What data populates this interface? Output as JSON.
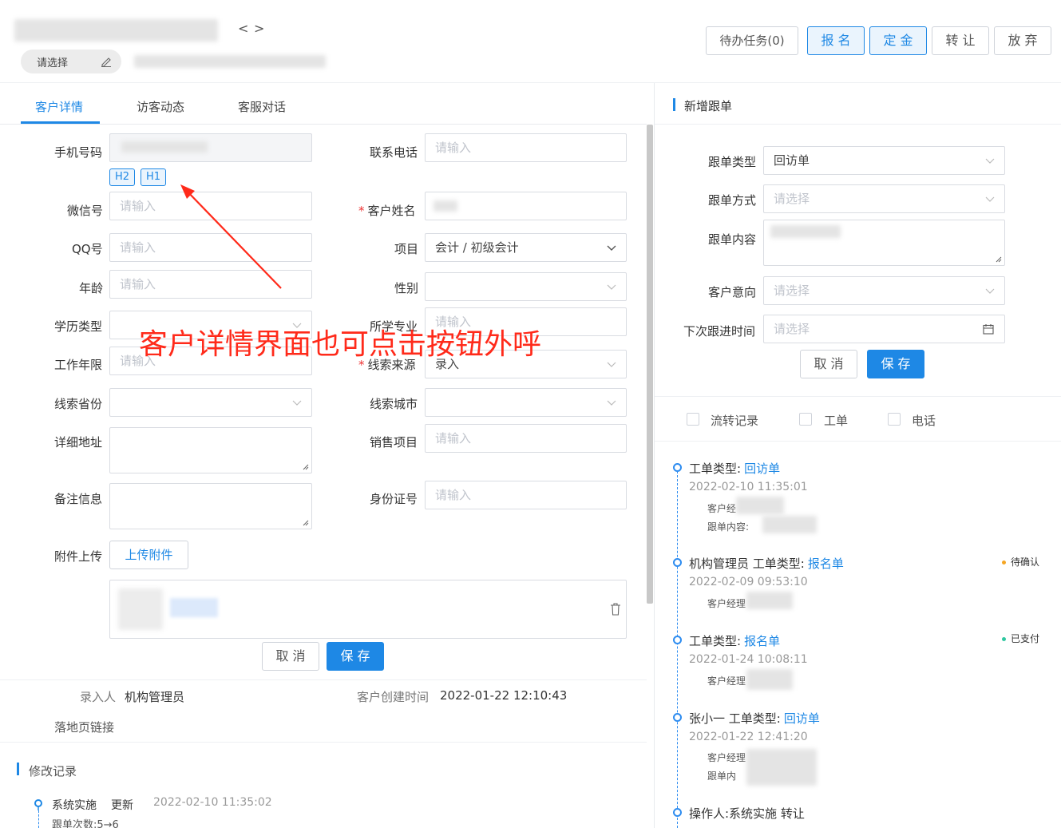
{
  "header": {
    "nav_prev": "<",
    "nav_next": ">",
    "select_placeholder": "请选择",
    "buttons": {
      "todo": "待办任务(0)",
      "enroll": "报 名",
      "deposit": "定 金",
      "transfer": "转 让",
      "abandon": "放 弃"
    }
  },
  "tabs": [
    "客户详情",
    "访客动态",
    "客服对话"
  ],
  "form": {
    "mobile_label": "手机号码",
    "tags": [
      "H2",
      "H1"
    ],
    "phone_label": "联系电话",
    "phone_placeholder": "请输入",
    "wechat_label": "微信号",
    "wechat_placeholder": "请输入",
    "name_label": "客户姓名",
    "qq_label": "QQ号",
    "qq_placeholder": "请输入",
    "project_label": "项目",
    "project_value": "会计 / 初级会计",
    "age_label": "年龄",
    "age_placeholder": "请输入",
    "gender_label": "性别",
    "edu_label": "学历类型",
    "major_label": "所学专业",
    "major_placeholder": "请输入",
    "work_label": "工作年限",
    "work_placeholder": "请输入",
    "source_label": "线索来源",
    "source_value": "录入",
    "province_label": "线索省份",
    "city_label": "线索城市",
    "address_label": "详细地址",
    "sales_label": "销售项目",
    "sales_placeholder": "请输入",
    "remark_label": "备注信息",
    "idcard_label": "身份证号",
    "idcard_placeholder": "请输入",
    "upload_label": "附件上传",
    "upload_button": "上传附件",
    "cancel": "取 消",
    "save": "保 存"
  },
  "annotation": "客户详情界面也可点击按钮外呼",
  "meta": {
    "creator_label": "录入人",
    "creator_value": "机构管理员",
    "created_label": "客户创建时间",
    "created_value": "2022-01-22 12:10:43",
    "landing_label": "落地页链接"
  },
  "history": {
    "title": "修改记录",
    "items": [
      {
        "user": "系统实施",
        "action": "更新",
        "time": "2022-02-10 11:35:02",
        "detail": "跟单次数:5→6"
      }
    ]
  },
  "followup": {
    "title": "新增跟单",
    "type_label": "跟单类型",
    "type_value": "回访单",
    "method_label": "跟单方式",
    "method_placeholder": "请选择",
    "content_label": "跟单内容",
    "intent_label": "客户意向",
    "intent_placeholder": "请选择",
    "next_label": "下次跟进时间",
    "next_placeholder": "请选择",
    "cancel": "取 消",
    "save": "保 存"
  },
  "filters": [
    "流转记录",
    "工单",
    "电话"
  ],
  "timeline": [
    {
      "prefix": "",
      "type_label": "工单类型:",
      "type_value": "回访单",
      "time": "2022-02-10 11:35:01",
      "status": "",
      "lines": [
        "客户经",
        "跟单内容:"
      ]
    },
    {
      "prefix": "机构管理员 ",
      "type_label": "工单类型:",
      "type_value": "报名单",
      "time": "2022-02-09 09:53:10",
      "status": "待确认",
      "lines": [
        "客户经理"
      ]
    },
    {
      "prefix": "",
      "type_label": "工单类型:",
      "type_value": "报名单",
      "time": "2022-01-24 10:08:11",
      "status": "已支付",
      "lines": [
        "客户经理"
      ]
    },
    {
      "prefix": "张小一 ",
      "type_label": "工单类型:",
      "type_value": "回访单",
      "time": "2022-01-22 12:41:20",
      "status": "",
      "lines": [
        "客户经理",
        "跟单内"
      ]
    },
    {
      "prefix": "",
      "type_label": "操作人:系统实施 转让",
      "type_value": "",
      "time": "",
      "status": "",
      "lines": []
    }
  ],
  "colors": {
    "accent": "#1e88e5",
    "annotation": "#ff2a1a",
    "pending": "#f5a623",
    "paid": "#2ec7a0"
  }
}
